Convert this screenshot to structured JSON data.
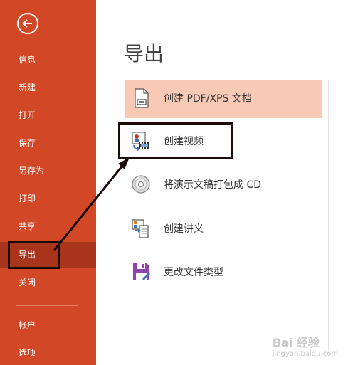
{
  "sidebar": {
    "items": [
      {
        "label": "信息"
      },
      {
        "label": "新建"
      },
      {
        "label": "打开"
      },
      {
        "label": "保存"
      },
      {
        "label": "另存为"
      },
      {
        "label": "打印"
      },
      {
        "label": "共享"
      },
      {
        "label": "导出"
      },
      {
        "label": "关闭"
      },
      {
        "label": "帐户"
      },
      {
        "label": "选项"
      }
    ],
    "active": "导出"
  },
  "main": {
    "title": "导出",
    "options": [
      {
        "label": "创建 PDF/XPS 文档",
        "icon": "pdf-document-icon"
      },
      {
        "label": "创建视频",
        "icon": "video-icon"
      },
      {
        "label": "将演示文稿打包成 CD",
        "icon": "cd-icon"
      },
      {
        "label": "创建讲义",
        "icon": "handout-icon"
      },
      {
        "label": "更改文件类型",
        "icon": "save-disk-icon"
      }
    ]
  },
  "colors": {
    "sidebar": "#d24726",
    "sidebar_active": "#a8351b",
    "selected_option": "#f8c9b5"
  },
  "watermark": {
    "brand": "Bai 经验",
    "sub": "jingyan.baidu.com"
  }
}
